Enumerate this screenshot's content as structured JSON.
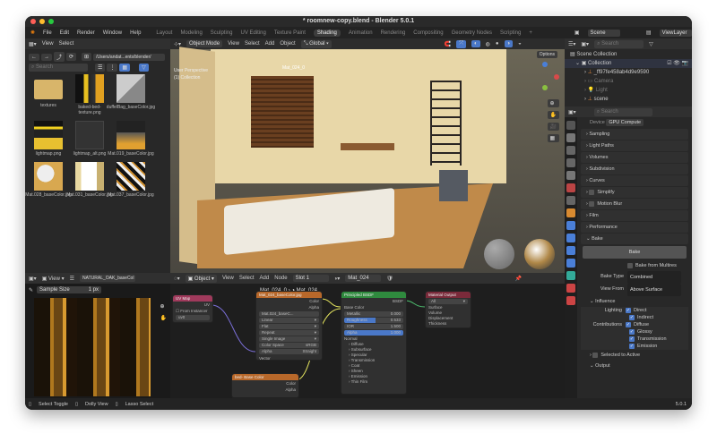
{
  "window": {
    "title": "* roomnew-copy.blend - Blender 5.0.1"
  },
  "menu": [
    "File",
    "Edit",
    "Render",
    "Window",
    "Help"
  ],
  "workspaces": [
    "Layout",
    "Modeling",
    "Sculpting",
    "UV Editing",
    "Texture Paint",
    "Shading",
    "Animation",
    "Rendering",
    "Compositing",
    "Geometry Nodes",
    "Scripting",
    "+"
  ],
  "active_workspace": "Shading",
  "scene": {
    "label": "Scene",
    "viewlayer": "ViewLayer"
  },
  "file_browser": {
    "menu": [
      "View",
      "Select"
    ],
    "path": "/Users/andat...ents/blender/",
    "search_placeholder": "Search",
    "items": [
      {
        "name": "textures",
        "type": "folder"
      },
      {
        "name": "baked-bed-texture.png"
      },
      {
        "name": "duffelBag_baseColor.jpg"
      },
      {
        "name": "lightmap.png"
      },
      {
        "name": "lightmap_alt.png"
      },
      {
        "name": "Mat.019_baseColor.jpg"
      },
      {
        "name": "Mat.028_baseColor.jpg"
      },
      {
        "name": "Mat.031_baseColor.jpg"
      },
      {
        "name": "Mat.037_baseColor.jpg"
      }
    ]
  },
  "viewport": {
    "mode": "Object Mode",
    "menu": [
      "View",
      "Select",
      "Add",
      "Object"
    ],
    "orientation": "Global",
    "options": "Options",
    "overlay_title": "User Perspective",
    "overlay_collection": "(1) Collection",
    "object_label": "Mat_024_0"
  },
  "outliner": {
    "search_placeholder": "Search",
    "items": [
      {
        "name": "Scene Collection",
        "depth": 0
      },
      {
        "name": "Collection",
        "depth": 1
      },
      {
        "name": "_ff97fe458ab4d9e9590",
        "depth": 2
      },
      {
        "name": "Camera",
        "depth": 2
      },
      {
        "name": "Light",
        "depth": 2
      },
      {
        "name": "scene",
        "depth": 2
      }
    ]
  },
  "properties": {
    "search_placeholder": "Search",
    "device_label": "Device",
    "device_value": "GPU Compute",
    "panels": [
      "Sampling",
      "Light Paths",
      "Volumes",
      "Subdivision",
      "Curves",
      "Simplify",
      "Motion Blur",
      "Film",
      "Performance"
    ],
    "bake": {
      "title": "Bake",
      "button": "Bake",
      "multires": "Bake from Multires",
      "type_label": "Bake Type",
      "type_value": "Combined",
      "view_label": "View From",
      "view_value": "Above Surface",
      "influence": "Influence",
      "lighting_label": "Lighting",
      "lighting": [
        "Direct",
        "Indirect"
      ],
      "contrib_label": "Contributions",
      "contributions": [
        "Diffuse",
        "Glossy",
        "Transmission",
        "Emission"
      ],
      "selected_to_active": "Selected to Active",
      "output": "Output"
    }
  },
  "image_editor": {
    "view": "View",
    "image_name": "NATURAL_OAK_baseCol",
    "sample_label": "Sample Size",
    "sample_value": "1 px"
  },
  "node_editor": {
    "type": "Object",
    "menu": [
      "View",
      "Select",
      "Add",
      "Node"
    ],
    "slot": "Slot 1",
    "material": "Mat_024",
    "breadcrumb_obj": "Mat_024_0",
    "breadcrumb_mat": "Mat_024",
    "uv_node": {
      "title": "UV Map",
      "out": "UV",
      "from_instancer": "From Instancer",
      "map": "uv0"
    },
    "image_node": {
      "title": "Mat_024_baseColor.jpg",
      "out_color": "Color",
      "out_alpha": "Alpha",
      "image": "Mat.024_baseC...",
      "interp": "Linear",
      "proj": "Flat",
      "ext": "Repeat",
      "source": "Single Image",
      "cs_label": "Color Space",
      "cs": "sRGB",
      "alpha_label": "Alpha",
      "alpha": "Straight",
      "vector": "Vector"
    },
    "bsdf_node": {
      "title": "Principled BSDF",
      "out": "BSDF",
      "base": "Base Color",
      "rows": [
        {
          "k": "Metallic",
          "v": "0.000"
        },
        {
          "k": "Roughness",
          "v": "0.533"
        },
        {
          "k": "IOR",
          "v": "1.500"
        },
        {
          "k": "Alpha",
          "v": "1.000"
        }
      ],
      "normal": "Normal",
      "subs": [
        "Diffuse",
        "Subsurface",
        "Specular",
        "Transmission",
        "Coat",
        "Sheen",
        "Emission",
        "Thin Film"
      ]
    },
    "output_node": {
      "title": "Material Output",
      "target": "All",
      "inputs": [
        "Surface",
        "Volume",
        "Displacement",
        "Thickness"
      ]
    },
    "bake_node": {
      "title": "bed- Base Color",
      "out": "Color",
      "alpha": "Alpha"
    }
  },
  "status": {
    "items": [
      "Select Toggle",
      "Dolly View",
      "Lasso Select"
    ],
    "version": "5.0.1"
  }
}
